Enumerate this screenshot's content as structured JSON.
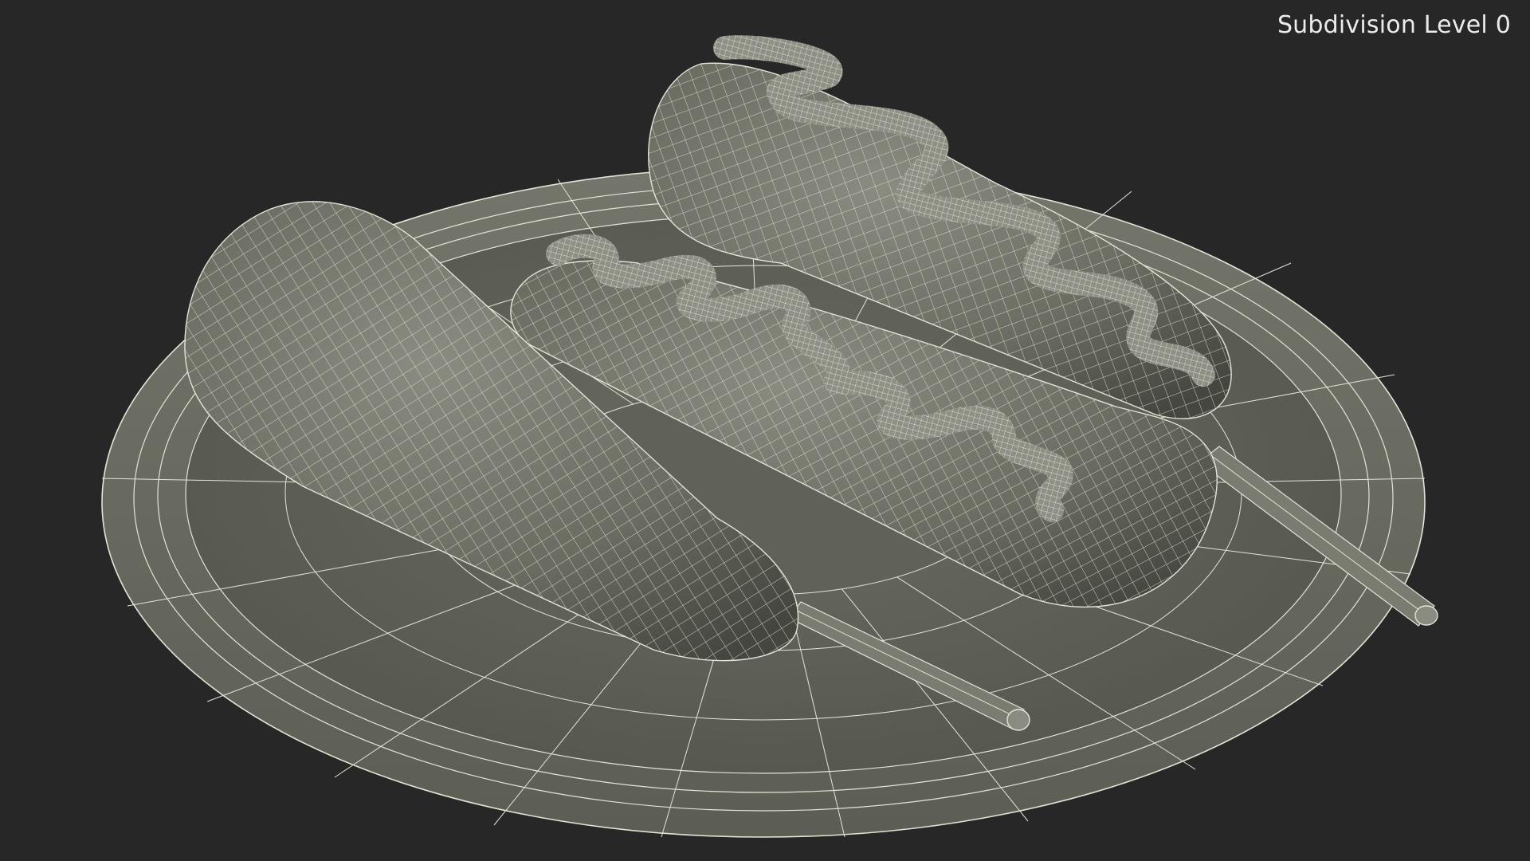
{
  "viewport": {
    "label": "Subdivision Level 0",
    "background_color": "#272727",
    "model_color": "#6e7066",
    "wire_color": "#e4e3d6"
  },
  "scene": {
    "objects": [
      "plate",
      "corn-dog-left",
      "corn-dog-center",
      "corn-dog-back",
      "stick-left",
      "stick-right"
    ]
  }
}
